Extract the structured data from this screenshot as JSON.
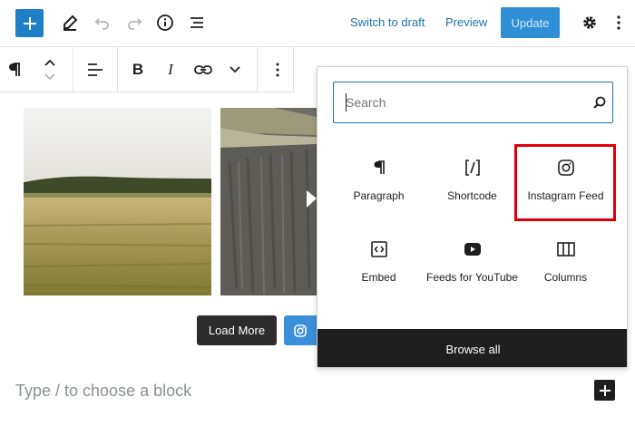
{
  "header": {
    "switch_to_draft": "Switch to draft",
    "preview": "Preview",
    "update": "Update"
  },
  "block_toolbar": {
    "bold": "B",
    "italic": "I"
  },
  "gallery": {
    "load_more": "Load More"
  },
  "editor": {
    "placeholder": "Type / to choose a block"
  },
  "inserter": {
    "search_placeholder": "Search",
    "blocks": [
      {
        "label": "Paragraph",
        "icon": "paragraph-icon"
      },
      {
        "label": "Shortcode",
        "icon": "shortcode-icon"
      },
      {
        "label": "Instagram Feed",
        "icon": "instagram-icon"
      },
      {
        "label": "Embed",
        "icon": "embed-icon"
      },
      {
        "label": "Feeds for YouTube",
        "icon": "youtube-icon"
      },
      {
        "label": "Columns",
        "icon": "columns-icon"
      }
    ],
    "browse_all": "Browse all"
  },
  "colors": {
    "accent": "#2271b1",
    "highlight": "#e0000b",
    "dark": "#1e1e1e"
  }
}
